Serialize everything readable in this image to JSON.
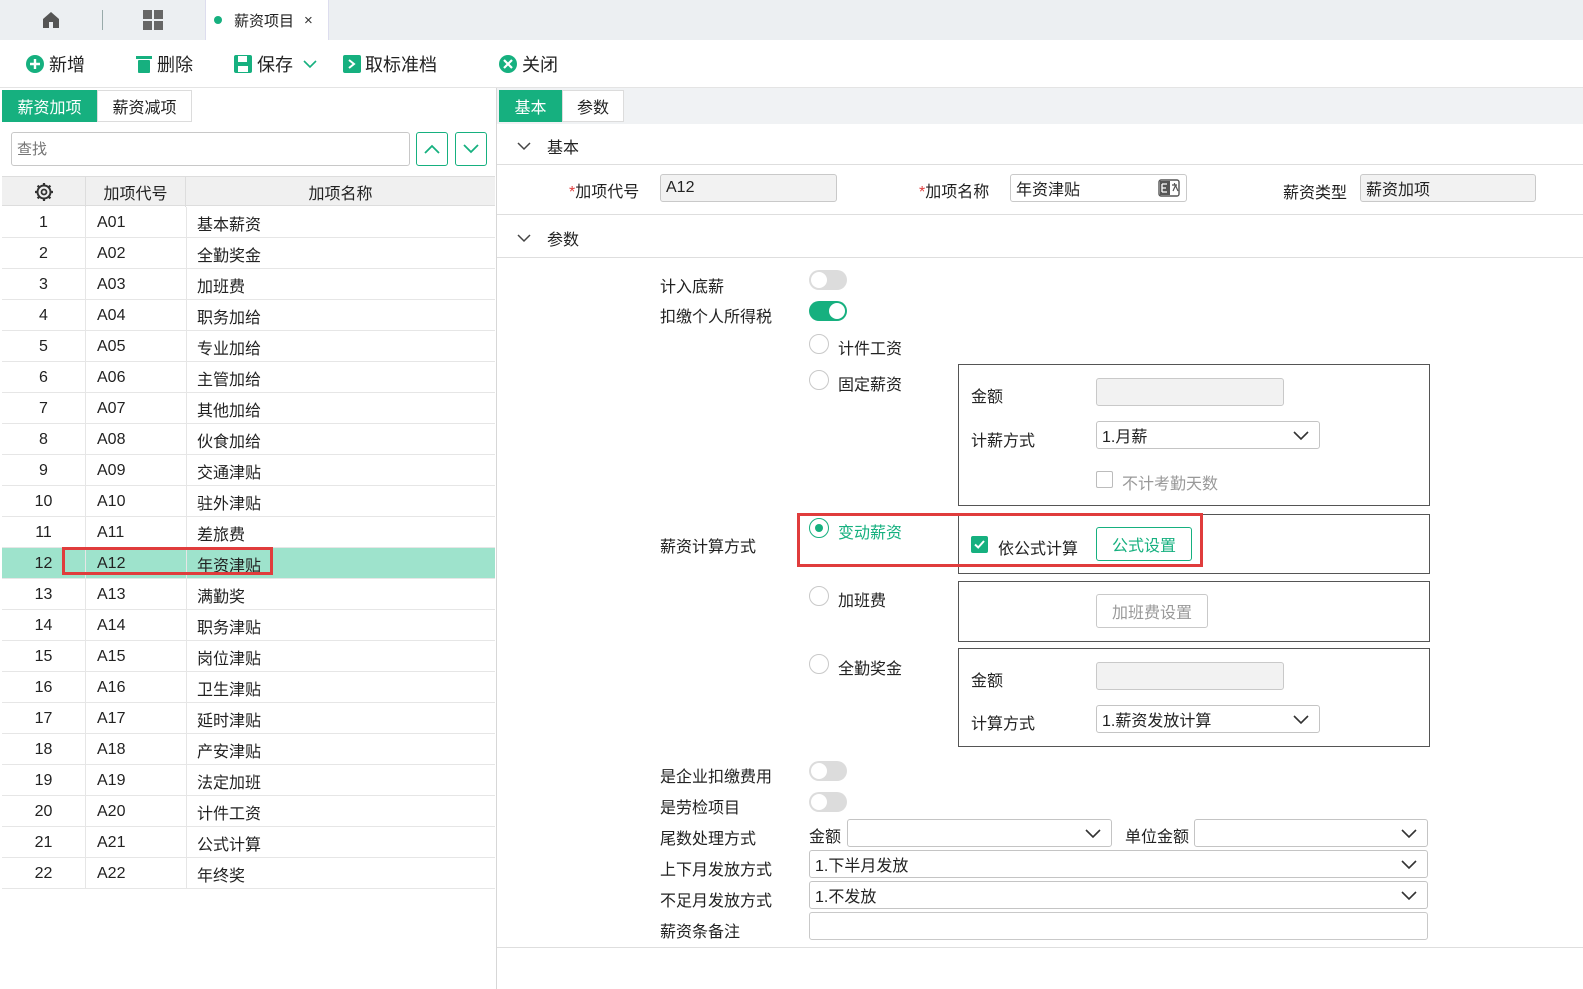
{
  "tabbar": {
    "home_icon": "home-icon",
    "grid_icon": "grid-icon",
    "active_tab": "薪资项目",
    "close_glyph": "×"
  },
  "toolbar": {
    "add": "新增",
    "delete": "删除",
    "save": "保存",
    "unstandard": "取标准档",
    "close": "关闭"
  },
  "left": {
    "tabs": [
      "薪资加项",
      "薪资减项"
    ],
    "search_placeholder": "查找",
    "columns": [
      "加项代号",
      "加项名称"
    ],
    "rows": [
      {
        "n": "1",
        "code": "A01",
        "name": "基本薪资"
      },
      {
        "n": "2",
        "code": "A02",
        "name": "全勤奖金"
      },
      {
        "n": "3",
        "code": "A03",
        "name": "加班费"
      },
      {
        "n": "4",
        "code": "A04",
        "name": "职务加给"
      },
      {
        "n": "5",
        "code": "A05",
        "name": "专业加给"
      },
      {
        "n": "6",
        "code": "A06",
        "name": "主管加给"
      },
      {
        "n": "7",
        "code": "A07",
        "name": "其他加给"
      },
      {
        "n": "8",
        "code": "A08",
        "name": "伙食加给"
      },
      {
        "n": "9",
        "code": "A09",
        "name": "交通津贴"
      },
      {
        "n": "10",
        "code": "A10",
        "name": "驻外津贴"
      },
      {
        "n": "11",
        "code": "A11",
        "name": "差旅费"
      },
      {
        "n": "12",
        "code": "A12",
        "name": "年资津贴"
      },
      {
        "n": "13",
        "code": "A13",
        "name": "满勤奖"
      },
      {
        "n": "14",
        "code": "A14",
        "name": "职务津贴"
      },
      {
        "n": "15",
        "code": "A15",
        "name": "岗位津贴"
      },
      {
        "n": "16",
        "code": "A16",
        "name": "卫生津贴"
      },
      {
        "n": "17",
        "code": "A17",
        "name": "延时津贴"
      },
      {
        "n": "18",
        "code": "A18",
        "name": "产安津贴"
      },
      {
        "n": "19",
        "code": "A19",
        "name": "法定加班"
      },
      {
        "n": "20",
        "code": "A20",
        "name": "计件工资"
      },
      {
        "n": "21",
        "code": "A21",
        "name": "公式计算"
      },
      {
        "n": "22",
        "code": "A22",
        "name": "年终奖"
      }
    ],
    "selected_row": "12"
  },
  "right": {
    "tabs": [
      "基本",
      "参数"
    ],
    "basic": {
      "section": "基本",
      "code_label": "加项代号",
      "code_value": "A12",
      "name_label": "加项名称",
      "name_value": "年资津贴",
      "type_label": "薪资类型",
      "type_value": "薪资加项"
    },
    "params": {
      "section": "参数",
      "include_base": "计入底薪",
      "deduct_tax": "扣缴个人所得税",
      "calc_method": "薪资计算方式",
      "opt_piece": "计件工资",
      "opt_fixed": "固定薪资",
      "fixed_amount_label": "金额",
      "fixed_pay_method_label": "计薪方式",
      "fixed_pay_method_value": "1.月薪",
      "fixed_no_attendance": "不计考勤天数",
      "opt_variable": "变动薪资",
      "by_formula": "依公式计算",
      "formula_btn": "公式设置",
      "opt_overtime": "加班费",
      "overtime_btn": "加班费设置",
      "opt_full_attendance": "全勤奖金",
      "fa_amount_label": "金额",
      "fa_calc_label": "计算方式",
      "fa_calc_value": "1.薪资发放计算",
      "company_deduct": "是企业扣缴费用",
      "labor_inspect": "是劳检项目",
      "rounding": "尾数处理方式",
      "rounding_amount": "金额",
      "rounding_unit": "单位金额",
      "split_month": "上下月发放方式",
      "split_month_value": "1.下半月发放",
      "partial_month": "不足月发放方式",
      "partial_month_value": "1.不发放",
      "remark": "薪资条备注"
    }
  },
  "colors": {
    "accent": "#16b07f",
    "selected_row": "#9ee3cc",
    "highlight": "#e03c3c"
  }
}
